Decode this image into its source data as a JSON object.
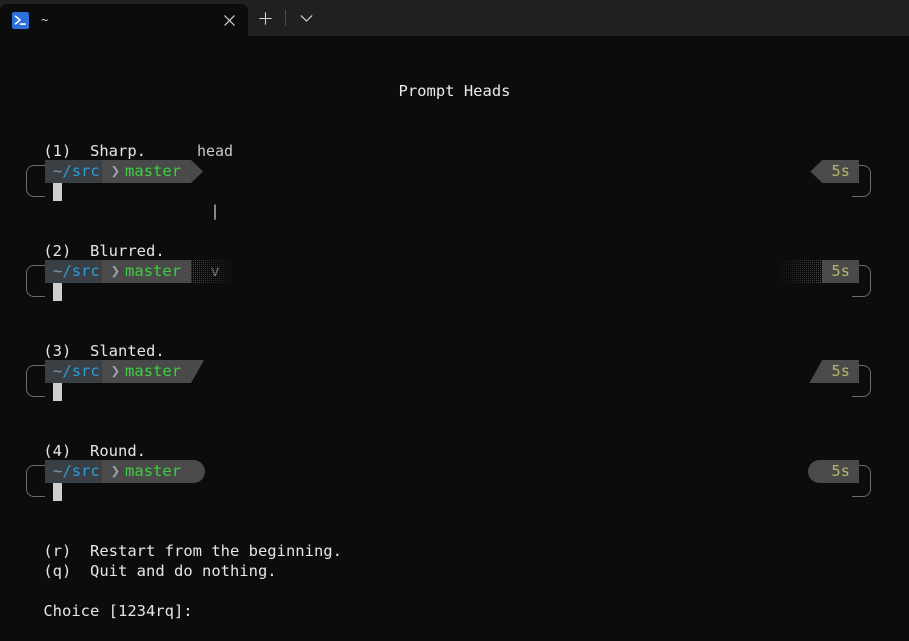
{
  "window": {
    "tab": {
      "title": "~",
      "icon": "terminal-prompt-icon"
    },
    "new_tab_label": "+",
    "dropdown_label": "⌄",
    "close_label": "✕"
  },
  "terminal": {
    "title": "Prompt Heads",
    "head_annotation": {
      "label": "head",
      "stem": "|",
      "arrow": "v"
    },
    "options": [
      {
        "key": "(1)",
        "label": "Sharp.",
        "style": "sharp"
      },
      {
        "key": "(2)",
        "label": "Blurred.",
        "style": "blurred"
      },
      {
        "key": "(3)",
        "label": "Slanted.",
        "style": "slanted"
      },
      {
        "key": "(4)",
        "label": "Round.",
        "style": "round"
      }
    ],
    "prompt": {
      "tilde": "~",
      "slash": "/",
      "dir": "src",
      "separator": "",
      "branch": "master",
      "duration": "5s"
    },
    "actions": [
      {
        "key": "(r)",
        "label": "Restart from the beginning."
      },
      {
        "key": "(q)",
        "label": "Quit and do nothing."
      }
    ],
    "choice_prompt": "Choice [1234rq]:"
  },
  "colors": {
    "background": "#0c0c0c",
    "titlebar": "#202020",
    "segment_path": "#3a3f44",
    "segment_git": "#4a4a4a",
    "path_blue": "#2f9bda",
    "branch_green": "#3fcf3f",
    "duration_olive": "#b5b56a",
    "bracket_gray": "#6d6d6d",
    "cursor": "#cfcfcf",
    "tab_icon_blue": "#2d6fdb"
  }
}
